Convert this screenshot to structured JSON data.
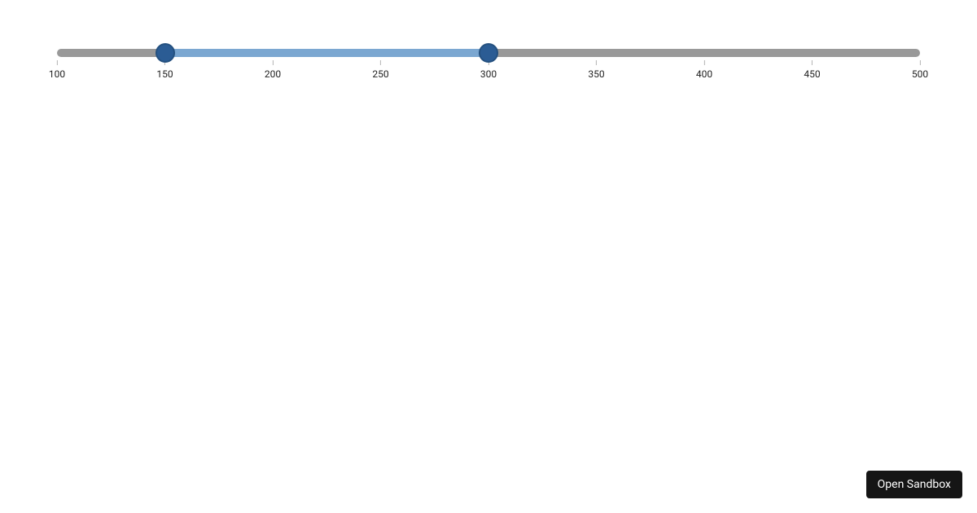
{
  "slider": {
    "min": 100,
    "max": 500,
    "low": 150,
    "high": 300,
    "ticks": [
      {
        "value": 100,
        "label": "100"
      },
      {
        "value": 150,
        "label": "150"
      },
      {
        "value": 200,
        "label": "200"
      },
      {
        "value": 250,
        "label": "250"
      },
      {
        "value": 300,
        "label": "300"
      },
      {
        "value": 350,
        "label": "350"
      },
      {
        "value": 400,
        "label": "400"
      },
      {
        "value": 450,
        "label": "450"
      },
      {
        "value": 500,
        "label": "500"
      }
    ]
  },
  "sandbox": {
    "label": "Open Sandbox"
  }
}
